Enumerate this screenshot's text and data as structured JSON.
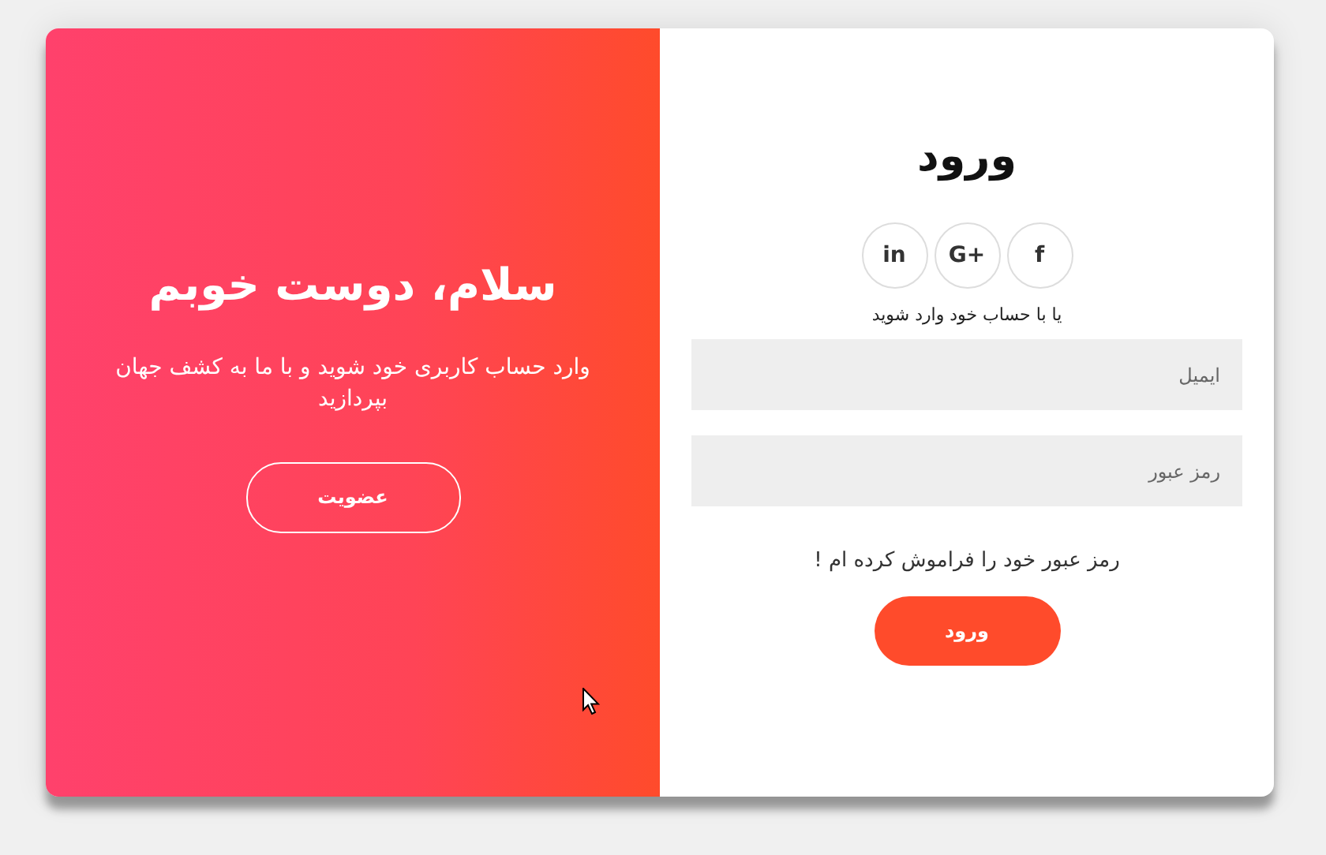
{
  "overlay": {
    "title": "سلام، دوست خوبم",
    "text": "وارد حساب کاربری خود شوید و با ما به کشف جهان بپردازید",
    "button": "عضویت"
  },
  "login": {
    "title": "ورود",
    "social": [
      {
        "label": "f"
      },
      {
        "label": "G+"
      },
      {
        "label": "in"
      }
    ],
    "hint": "یا با حساب خود وارد شوید",
    "fields": [
      {
        "placeholder": "ایمیل"
      },
      {
        "placeholder": "رمز عبور"
      }
    ],
    "forgot": "رمز عبور خود را فراموش کرده ام !",
    "button": "ورود"
  }
}
